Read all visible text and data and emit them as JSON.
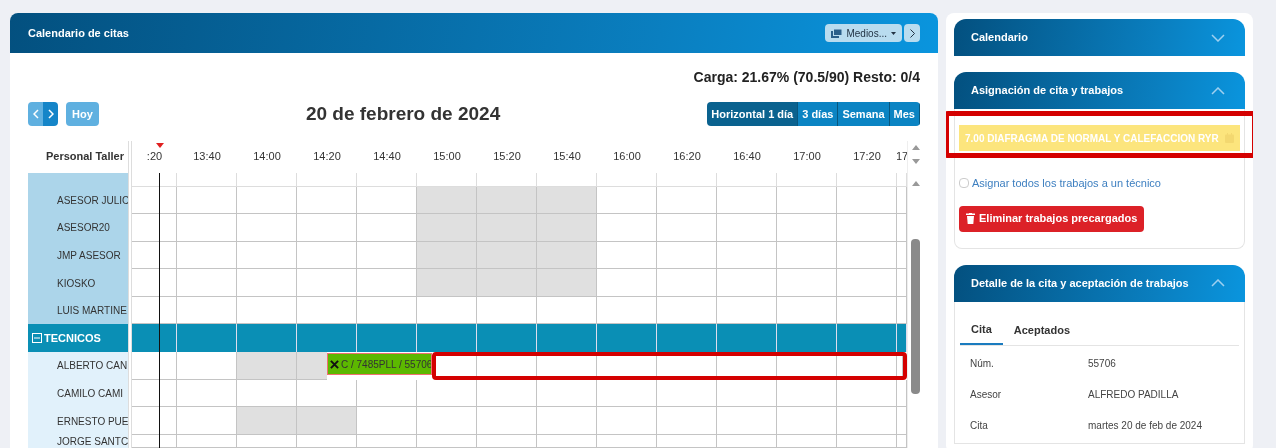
{
  "calendar_panel": {
    "title": "Calendario de citas",
    "media_button": "Medios...",
    "load_summary": "Carga: 21.67% (70.5/90) Resto: 0/4",
    "today_button": "Hoy",
    "date_title": "20 de febrero de 2024",
    "views": [
      {
        "label": "Horizontal 1 día",
        "selected": true
      },
      {
        "label": "3 días",
        "selected": false
      },
      {
        "label": "Semana",
        "selected": false
      },
      {
        "label": "Mes",
        "selected": false
      }
    ],
    "resource_header": "Personal Taller",
    "time_columns": [
      ":20",
      "13:40",
      "14:00",
      "14:20",
      "14:40",
      "15:00",
      "15:20",
      "15:40",
      "16:00",
      "16:20",
      "16:40",
      "17:00",
      "17:20",
      "17"
    ],
    "rows": [
      {
        "kind": "member",
        "name": "ASESOR JULIC",
        "unavailable": [
          false,
          false,
          false,
          false,
          false,
          true,
          true,
          true,
          false,
          false,
          false,
          false,
          false,
          false
        ]
      },
      {
        "kind": "member",
        "name": "ASESOR20",
        "unavailable": [
          false,
          false,
          false,
          false,
          false,
          true,
          true,
          true,
          false,
          false,
          false,
          false,
          false,
          false
        ]
      },
      {
        "kind": "member",
        "name": "JMP ASESOR",
        "unavailable": [
          false,
          false,
          false,
          false,
          false,
          true,
          true,
          true,
          false,
          false,
          false,
          false,
          false,
          false
        ]
      },
      {
        "kind": "member",
        "name": "KIOSKO",
        "unavailable": [
          false,
          false,
          false,
          false,
          false,
          true,
          true,
          true,
          false,
          false,
          false,
          false,
          false,
          false
        ]
      },
      {
        "kind": "member",
        "name": "LUIS MARTINE",
        "unavailable": [
          false,
          false,
          false,
          false,
          false,
          false,
          false,
          false,
          false,
          false,
          false,
          false,
          false,
          false
        ]
      },
      {
        "kind": "group",
        "name": "TECNICOS",
        "expanded": true
      },
      {
        "kind": "tech",
        "name": "ALBERTO CAN",
        "unavailable": [
          false,
          false,
          true,
          true,
          false,
          false,
          false,
          false,
          false,
          false,
          false,
          false,
          false
        ],
        "highlighted": true,
        "event": {
          "label": "C / 7485PLL / 55706"
        }
      },
      {
        "kind": "tech",
        "name": "CAMILO CAMI",
        "unavailable": [
          false,
          false,
          false,
          false,
          false,
          false,
          false,
          false,
          false,
          false,
          false,
          false,
          false,
          false
        ]
      },
      {
        "kind": "tech",
        "name": "ERNESTO PUE",
        "unavailable": [
          false,
          false,
          true,
          true,
          false,
          false,
          false,
          false,
          false,
          false,
          false,
          false,
          false,
          false
        ]
      },
      {
        "kind": "tech",
        "name": "JORGE SANTC",
        "unavailable": [
          false,
          false,
          false,
          false,
          false,
          false,
          false,
          false,
          false,
          false,
          false,
          false,
          false,
          false
        ]
      }
    ]
  },
  "sidebar": {
    "sections": [
      {
        "kind": "collapsed",
        "title": "Calendario",
        "expanded": false
      },
      {
        "kind": "assign",
        "title": "Asignación de cita y trabajos",
        "expanded": true,
        "job": {
          "label": "7.00 DIAFRAGMA DE NORMAL Y CALEFACCION RYR",
          "highlighted": true
        },
        "assign_all": {
          "label": "Asignar todos los trabajos a un técnico",
          "checked": false
        },
        "delete_button": "Eliminar trabajos precargados"
      },
      {
        "kind": "detail",
        "title": "Detalle de la cita y aceptación de trabajos",
        "expanded": true,
        "tabs": [
          {
            "label": "Cita",
            "selected": true
          },
          {
            "label": "Aceptados",
            "selected": false
          }
        ],
        "fields": [
          {
            "label": "Núm.",
            "value": "55706"
          },
          {
            "label": "Asesor",
            "value": "ALFREDO PADILLA"
          },
          {
            "label": "Cita",
            "value": "martes 20 de feb de 2024"
          }
        ]
      }
    ]
  }
}
